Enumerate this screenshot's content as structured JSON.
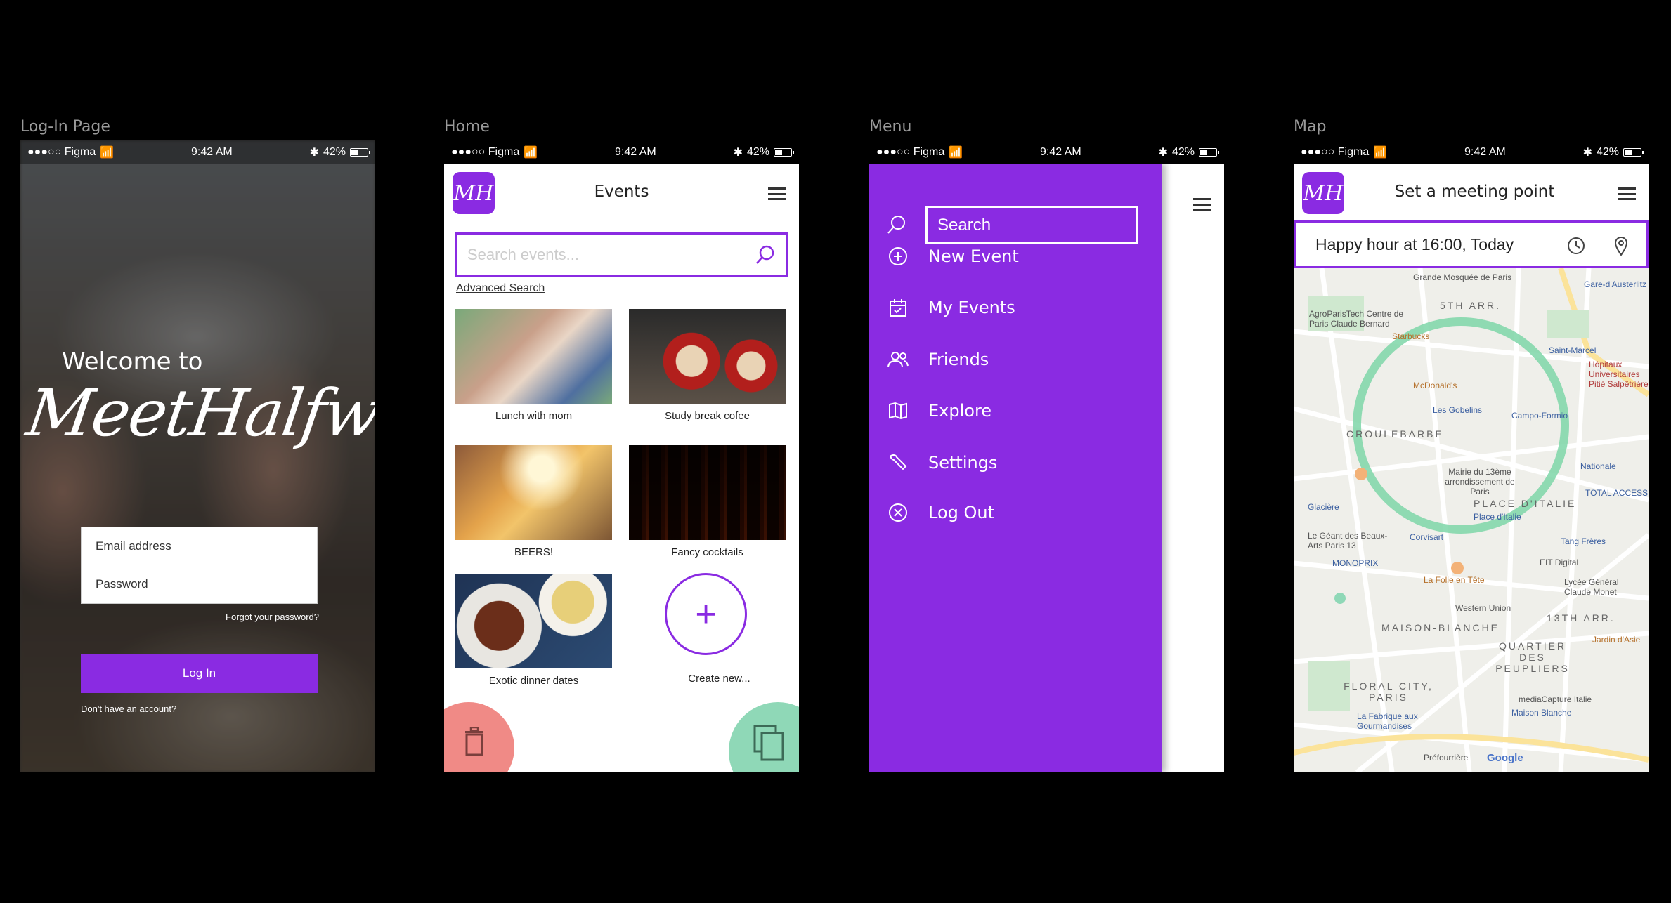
{
  "frames": {
    "login": "Log-In Page",
    "home": "Home",
    "menu": "Menu",
    "map": "Map"
  },
  "status": {
    "carrier": "●●●○○ Figma",
    "time": "9:42 AM",
    "battery": "42%"
  },
  "login": {
    "welcome": "Welcome to",
    "brand": "MeetHalfway",
    "email_placeholder": "Email address",
    "password_placeholder": "Password",
    "forgot": "Forgot your password?",
    "login_button": "Log In",
    "no_account": "Don't have an account?"
  },
  "app": {
    "logo": "MH"
  },
  "home": {
    "title": "Events",
    "search_placeholder": "Search events...",
    "advanced_search": "Advanced Search",
    "tiles": [
      {
        "label": "Lunch with mom"
      },
      {
        "label": "Study break cofee"
      },
      {
        "label": "BEERS!"
      },
      {
        "label": "Fancy cocktails"
      },
      {
        "label": "Exotic dinner dates"
      }
    ],
    "create_new": "Create new..."
  },
  "menu": {
    "search": "Search",
    "items": [
      {
        "label": "New Event",
        "icon": "plus-circle-icon"
      },
      {
        "label": "My Events",
        "icon": "calendar-icon"
      },
      {
        "label": "Friends",
        "icon": "people-icon"
      },
      {
        "label": "Explore",
        "icon": "map-icon"
      },
      {
        "label": "Settings",
        "icon": "wrench-icon"
      },
      {
        "label": "Log Out",
        "icon": "close-circle-icon"
      }
    ]
  },
  "map": {
    "title": "Set a meeting point",
    "event": "Happy hour at 16:00, Today",
    "labels": {
      "mosque": "Grande Mosquée de Paris",
      "arr5": "5TH ARR.",
      "agro": "AgroParisTech Centre de Paris Claude Bernard",
      "starbucks": "Starbucks",
      "mcdonalds": "McDonald's",
      "gobelins": "Les Gobelins",
      "campo": "Campo-Formio",
      "croulebarbe": "CROULEBARBE",
      "mairie": "Mairie du 13ème arrondissement de Paris",
      "place_italie": "PLACE D'ITALIE",
      "place_italie_station": "Place d'Italie",
      "glaciere": "Glacière",
      "geant": "Le Géant des Beaux-Arts Paris 13",
      "corvisart": "Corvisart",
      "monoprix": "MONOPRIX",
      "folie": "La Folie en Tête",
      "tang": "Tang Frères",
      "eit": "EIT Digital",
      "lycee": "Lycée Général Claude Monet",
      "western": "Western Union",
      "arr13": "13TH ARR.",
      "maison_blanche": "MAISON-BLANCHE",
      "quartier": "QUARTIER DES PEUPLIERS",
      "jardin": "Jardin d'Asie",
      "floral": "FLORAL CITY, PARIS",
      "media": "mediaCapture Italie",
      "maison_station": "Maison Blanche",
      "fabrique": "La Fabrique aux Gourmandises",
      "prefourriere": "Préfourrière",
      "google": "Google",
      "hopitaux": "Hôpitaux Universitaires Pitié Salpêtrière",
      "total": "TOTAL ACCESS",
      "nationale": "Nationale",
      "saint_marcel": "Saint-Marcel",
      "gare": "Gare-d'Austerlitz"
    }
  },
  "colors": {
    "accent": "#8a2be2",
    "trash": "#f08a86",
    "copy": "#8fd8b7",
    "radius_ring": "#7ed6a8"
  }
}
